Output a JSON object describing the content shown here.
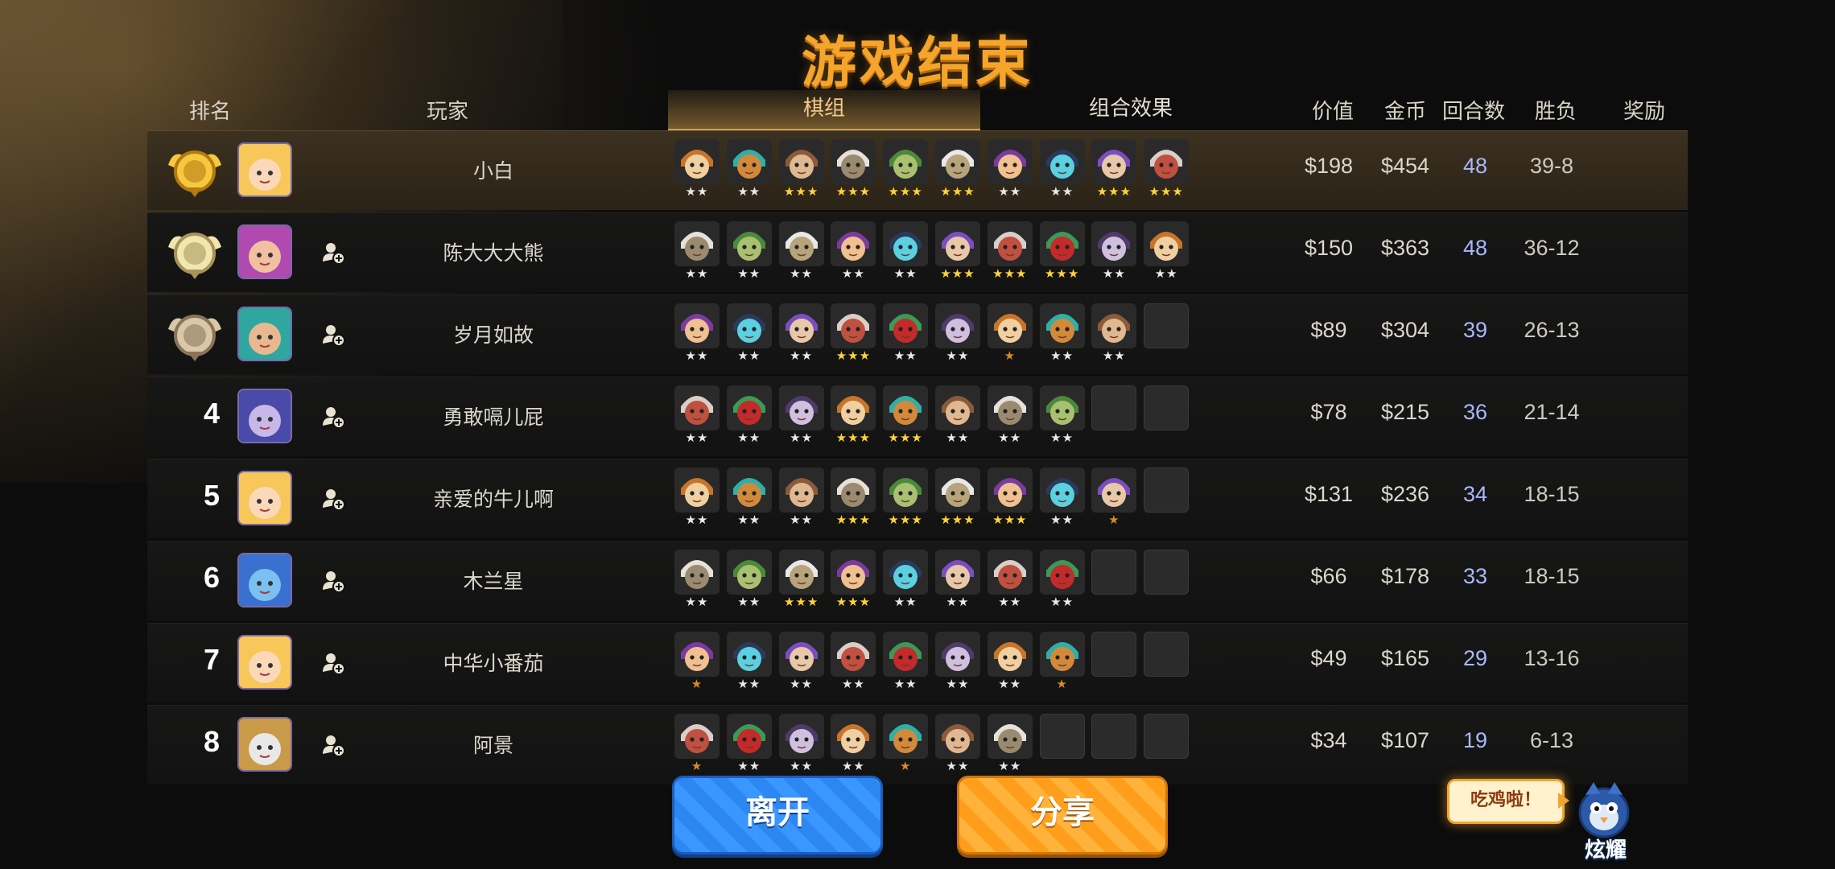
{
  "title": "游戏结束",
  "headers": {
    "rank": "排名",
    "player": "玩家",
    "value": "价值",
    "gold": "金币",
    "rounds": "回合数",
    "win_loss": "胜负",
    "reward": "奖励"
  },
  "tabs": [
    {
      "label": "棋组",
      "active": true
    },
    {
      "label": "组合效果",
      "active": false
    }
  ],
  "players": [
    {
      "rank": "1",
      "rank_display": "medal-gold",
      "name": "小白",
      "value": "$198",
      "gold": "$454",
      "rounds": "48",
      "win_loss": "39-8",
      "add_friend": false,
      "pieces": [
        2,
        2,
        3,
        3,
        3,
        3,
        2,
        2,
        3,
        3
      ]
    },
    {
      "rank": "2",
      "rank_display": "medal-silver",
      "name": "陈大大大熊",
      "value": "$150",
      "gold": "$363",
      "rounds": "48",
      "win_loss": "36-12",
      "add_friend": true,
      "pieces": [
        2,
        2,
        2,
        2,
        2,
        3,
        3,
        3,
        2,
        2
      ]
    },
    {
      "rank": "3",
      "rank_display": "medal-bronze",
      "name": "岁月如故",
      "value": "$89",
      "gold": "$304",
      "rounds": "39",
      "win_loss": "26-13",
      "add_friend": true,
      "pieces": [
        2,
        2,
        2,
        3,
        2,
        2,
        1,
        2,
        2,
        0
      ]
    },
    {
      "rank": "4",
      "rank_display": "number",
      "name": "勇敢嗝儿屁",
      "value": "$78",
      "gold": "$215",
      "rounds": "36",
      "win_loss": "21-14",
      "add_friend": true,
      "pieces": [
        2,
        2,
        2,
        3,
        3,
        2,
        2,
        2,
        0,
        0
      ]
    },
    {
      "rank": "5",
      "rank_display": "number",
      "name": "亲爱的牛儿啊",
      "value": "$131",
      "gold": "$236",
      "rounds": "34",
      "win_loss": "18-15",
      "add_friend": true,
      "pieces": [
        2,
        2,
        2,
        3,
        3,
        3,
        3,
        2,
        1,
        0
      ]
    },
    {
      "rank": "6",
      "rank_display": "number",
      "name": "木兰星",
      "value": "$66",
      "gold": "$178",
      "rounds": "33",
      "win_loss": "18-15",
      "add_friend": true,
      "pieces": [
        2,
        2,
        3,
        3,
        2,
        2,
        2,
        2,
        0,
        0
      ]
    },
    {
      "rank": "7",
      "rank_display": "number",
      "name": "中华小番茄",
      "value": "$49",
      "gold": "$165",
      "rounds": "29",
      "win_loss": "13-16",
      "add_friend": true,
      "pieces": [
        1,
        2,
        2,
        2,
        2,
        2,
        2,
        1,
        0,
        0
      ]
    },
    {
      "rank": "8",
      "rank_display": "number",
      "name": "阿景",
      "value": "$34",
      "gold": "$107",
      "rounds": "19",
      "win_loss": "6-13",
      "add_friend": true,
      "pieces": [
        1,
        2,
        2,
        2,
        1,
        2,
        2,
        0,
        0,
        0
      ]
    }
  ],
  "buttons": {
    "leave": "离开",
    "share": "分享"
  },
  "brag": {
    "bubble": "吃鸡啦！",
    "label": "炫耀"
  },
  "colors": {
    "title": "#f5a52a",
    "rounds": "#a9b8ff",
    "star_gold": "#ffd23a",
    "star_silver": "#e8e8e8",
    "star_bronze": "#d98a2a"
  }
}
